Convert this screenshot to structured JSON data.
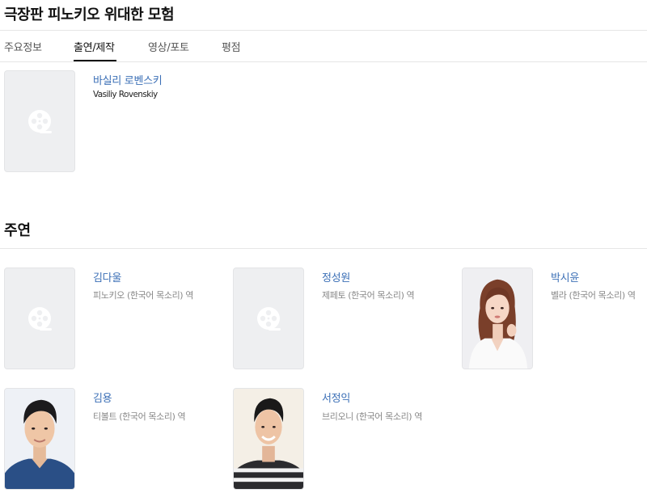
{
  "page": {
    "title": "극장판 피노키오 위대한 모험"
  },
  "tabs": [
    {
      "label": "주요정보"
    },
    {
      "label": "출연/제작",
      "active": true
    },
    {
      "label": "영상/포토"
    },
    {
      "label": "평점"
    }
  ],
  "director": {
    "name": "바실리 로벤스키",
    "name_en": "Vasiliy Rovenskiy"
  },
  "cast_section": {
    "title": "주연"
  },
  "cast": [
    {
      "name": "김다울",
      "role": "피노키오 (한국어 목소리) 역",
      "photo": "placeholder-icon"
    },
    {
      "name": "정성원",
      "role": "제페토 (한국어 목소리) 역",
      "photo": "placeholder-icon"
    },
    {
      "name": "박시윤",
      "role": "벨라 (한국어 목소리) 역",
      "photo": "portrait"
    },
    {
      "name": "김용",
      "role": "티볼트 (한국어 목소리) 역",
      "photo": "portrait"
    },
    {
      "name": "서정익",
      "role": "브리오니 (한국어 목소리) 역",
      "photo": "portrait"
    }
  ],
  "colors": {
    "link": "#3b6fb6",
    "placeholder_bg": "#eeeff1"
  }
}
